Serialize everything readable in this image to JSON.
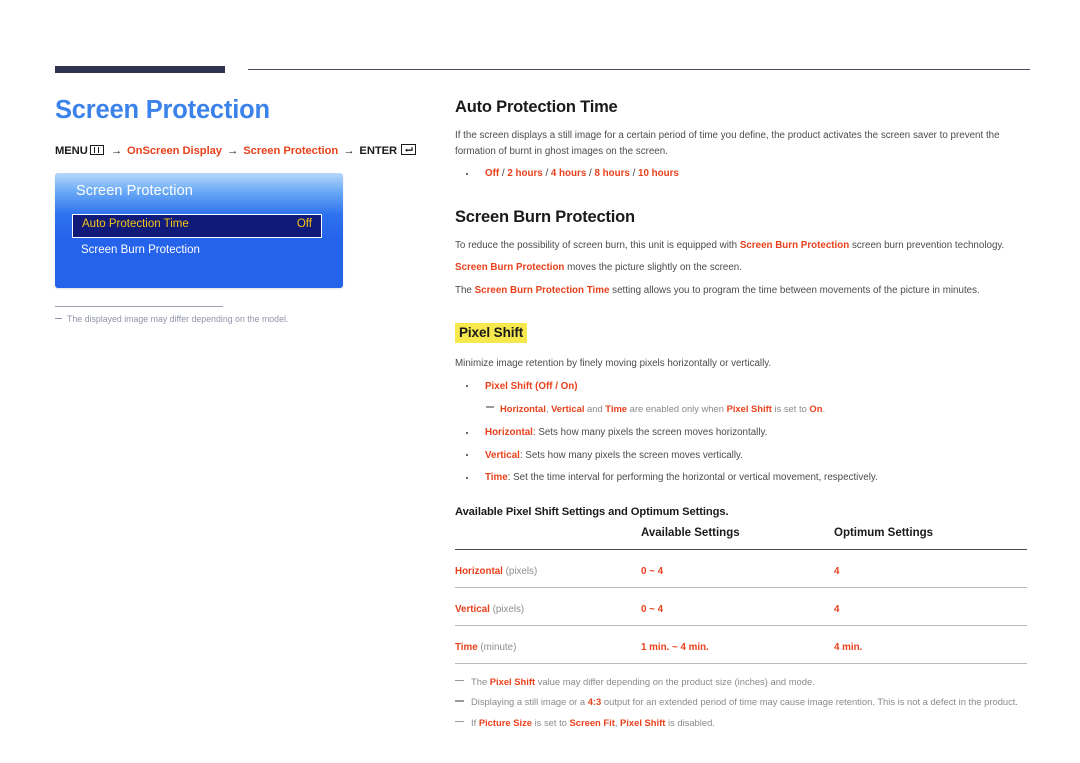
{
  "left": {
    "chapter_title": "Screen Protection",
    "menu_path": {
      "menu_label": "MENU",
      "menu_icon": "menu-grid-icon",
      "arrow": "→",
      "step1": "OnScreen Display",
      "step2": "Screen Protection",
      "enter_label": "ENTER",
      "enter_icon": "enter-key-icon"
    },
    "osd": {
      "title": "Screen Protection",
      "selected_row_label": "Auto Protection Time",
      "selected_row_value": "Off",
      "row2_label": "Screen Burn Protection"
    },
    "note": "The displayed image may differ depending on the model."
  },
  "right": {
    "auto_protection": {
      "heading": "Auto Protection Time",
      "paragraph": "If the screen displays a still image for a certain period of time you define, the product activates the screen saver to prevent the formation of burnt in ghost images on the screen.",
      "options": [
        "Off",
        "2 hours",
        "4 hours",
        "8 hours",
        "10 hours"
      ]
    },
    "screen_burn": {
      "heading": "Screen Burn Protection",
      "p1_a": "To reduce the possibility of screen burn, this unit is equipped with ",
      "p1_b": "Screen Burn Protection",
      "p1_c": " screen burn prevention technology.",
      "p2_a": "Screen Burn Protection",
      "p2_b": " moves the picture slightly on the screen.",
      "p3_a": "The ",
      "p3_b": "Screen Burn Protection Time",
      "p3_c": " setting allows you to program the time between movements of the picture in minutes."
    },
    "pixel_shift": {
      "heading": "Pixel Shift",
      "intro": "Minimize image retention by finely moving pixels horizontally or vertically.",
      "bullet1_name": "Pixel Shift",
      "bullet1_values": "(Off / On)",
      "subnote_a": "Horizontal",
      "subnote_b": ", ",
      "subnote_c": "Vertical",
      "subnote_d": " and ",
      "subnote_e": "Time",
      "subnote_f": " are enabled only when ",
      "subnote_g": "Pixel Shift",
      "subnote_h": " is set to ",
      "subnote_i": "On",
      "subnote_j": ".",
      "bullet2_name": "Horizontal",
      "bullet2_text": ": Sets how many pixels the screen moves horizontally.",
      "bullet3_name": "Vertical",
      "bullet3_text": ": Sets how many pixels the screen moves vertically.",
      "bullet4_name": "Time",
      "bullet4_text": ": Set the time interval for performing the horizontal or vertical movement, respectively."
    },
    "table": {
      "caption": "Available Pixel Shift Settings and Optimum Settings.",
      "headers": [
        "",
        "Available Settings",
        "Optimum Settings"
      ],
      "rows": [
        {
          "label": "Horizontal",
          "unit": " (pixels)",
          "available": "0 ~ 4",
          "optimum": "4"
        },
        {
          "label": "Vertical",
          "unit": " (pixels)",
          "available": "0 ~ 4",
          "optimum": "4"
        },
        {
          "label": "Time",
          "unit": " (minute)",
          "available": "1 min. ~ 4 min.",
          "optimum": "4 min."
        }
      ]
    },
    "footnotes": [
      {
        "a": "The ",
        "b": "Pixel Shift",
        "c": " value may differ depending on the product size (inches) and mode."
      },
      {
        "a": "Displaying a still image or a ",
        "b": "4:3",
        "c": " output for an extended period of time may cause image retention. This is not a defect in the product."
      },
      {
        "a": "If ",
        "b": "Picture Size",
        "c": " is set to ",
        "d": "Screen Fit",
        "e": ", ",
        "f": "Pixel Shift",
        "g": " is disabled."
      }
    ]
  },
  "colors": {
    "accent_red": "#e8411c",
    "title_blue": "#3b82ea",
    "osd_blue": "#2563eb",
    "osd_select_bg": "#101a78",
    "osd_select_text": "#f5c518",
    "highlight_yellow": "#f7e84e",
    "rule_navy": "#2e3450"
  }
}
